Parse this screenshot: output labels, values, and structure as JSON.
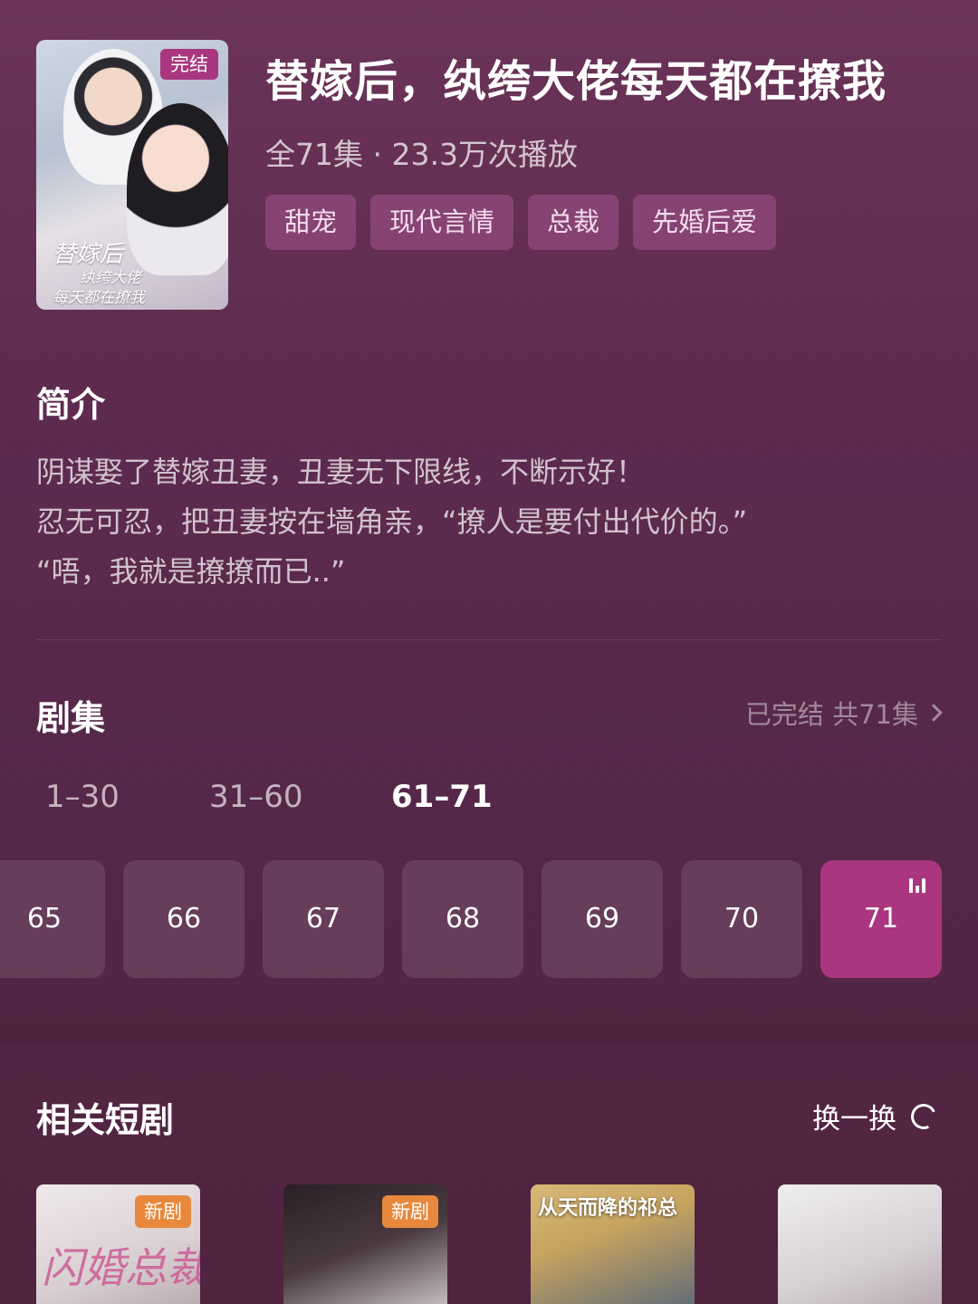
{
  "drama": {
    "badge": "完结",
    "title": "替嫁后，纨绔大佬每天都在撩我",
    "meta": "全71集 · 23.3万次播放",
    "tags": [
      "甜宠",
      "现代言情",
      "总裁",
      "先婚后爱"
    ],
    "cover_text": [
      "替嫁后",
      "纨绔大佬",
      "每天都在撩我"
    ]
  },
  "intro": {
    "heading": "简介",
    "lines": [
      "阴谋娶了替嫁丑妻，丑妻无下限线，不断示好！",
      "忍无可忍，把丑妻按在墙角亲，“撩人是要付出代价的。”",
      "“唔，我就是撩撩而已..”"
    ]
  },
  "episodes": {
    "heading": "剧集",
    "status": "已完结 共71集",
    "ranges": [
      "1–30",
      "31–60",
      "61–71"
    ],
    "active_range": "61–71",
    "items": [
      "65",
      "66",
      "67",
      "68",
      "69",
      "70",
      "71"
    ],
    "current": "71"
  },
  "related": {
    "heading": "相关短剧",
    "refresh_label": "换一换",
    "items": [
      {
        "badge": "新剧",
        "cover_title": "闪婚总裁"
      },
      {
        "badge": "新剧",
        "cover_title": ""
      },
      {
        "badge": "",
        "cover_title": "从天而降的祁总"
      },
      {
        "badge": "",
        "cover_title": ""
      }
    ]
  },
  "icons": {
    "status_chevron": "chevron-right-icon",
    "playing": "equalizer-icon",
    "refresh": "refresh-icon"
  },
  "colors": {
    "accent": "#a9367e",
    "new_badge": "#e8883c",
    "tag_bg": "#7d3f6b"
  }
}
